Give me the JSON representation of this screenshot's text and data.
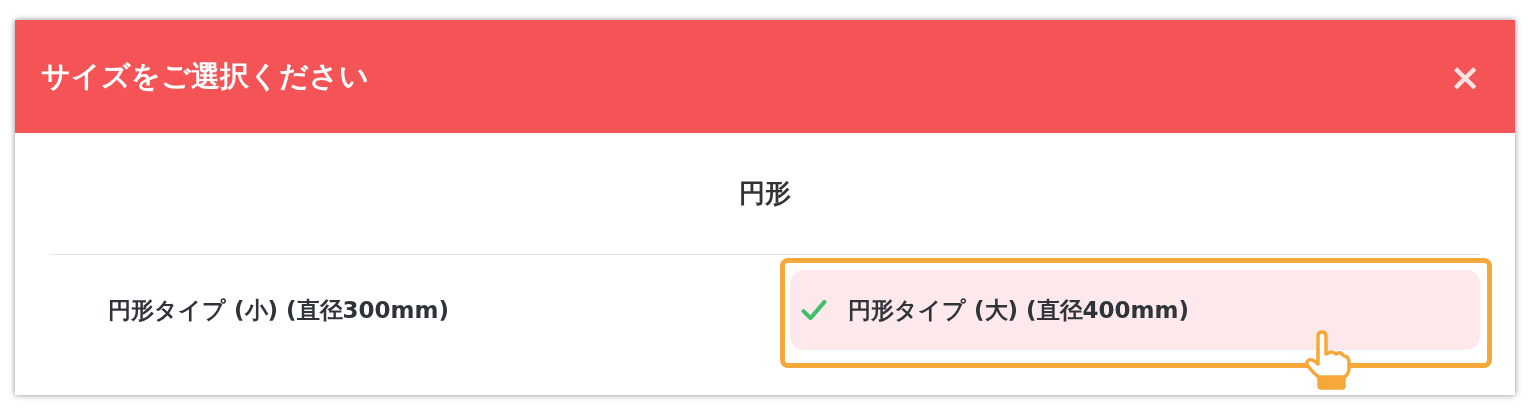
{
  "dialog": {
    "title": "サイズをご選択ください",
    "close": "×"
  },
  "section": {
    "title": "円形"
  },
  "options": [
    {
      "label": "円形タイプ (小) (直径300mm)",
      "selected": false,
      "highlighted": false
    },
    {
      "label": "円形タイプ (大) (直径400mm)",
      "selected": true,
      "highlighted": true
    }
  ]
}
